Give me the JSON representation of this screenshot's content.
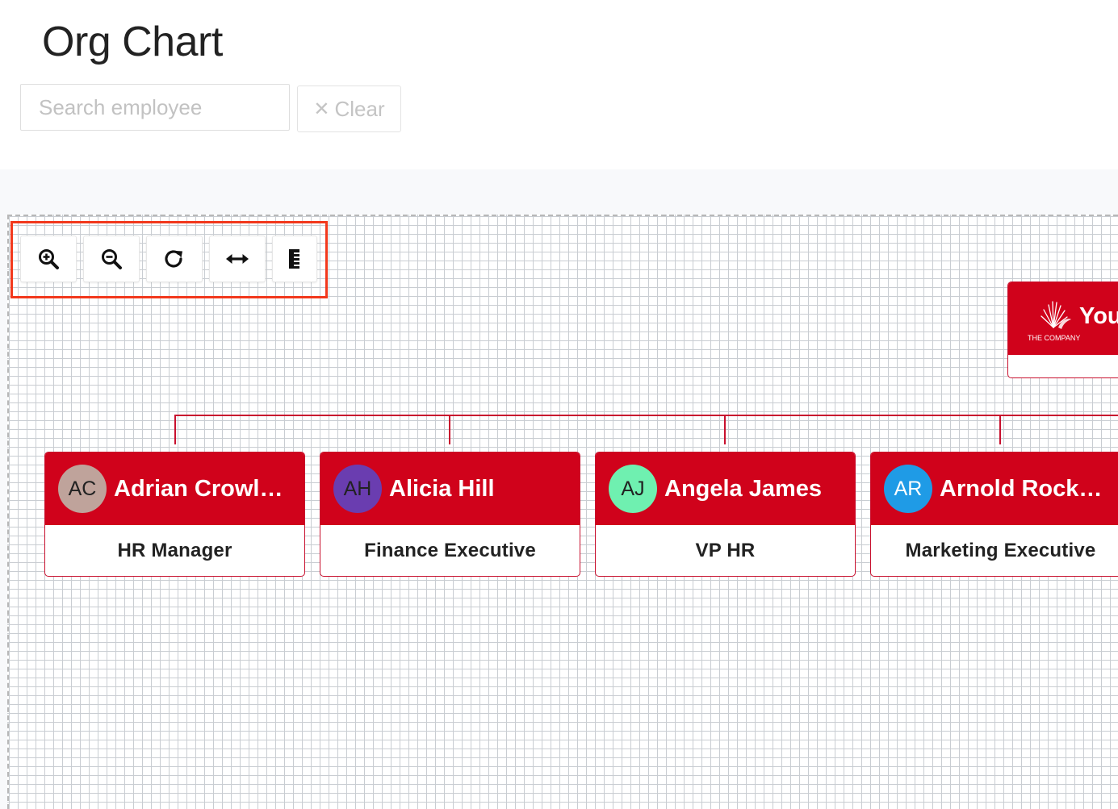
{
  "header": {
    "title": "Org Chart"
  },
  "search": {
    "placeholder": "Search employee",
    "value": "",
    "clear_icon": "✕",
    "clear_label": "Clear"
  },
  "toolbar": {
    "buttons": [
      {
        "icon": "zoom-in-icon"
      },
      {
        "icon": "zoom-out-icon"
      },
      {
        "icon": "refresh-icon"
      },
      {
        "icon": "expand-horizontal-icon"
      },
      {
        "icon": "list-icon"
      }
    ]
  },
  "colors": {
    "accent": "#d0021b",
    "highlight": "#f2381c"
  },
  "root": {
    "name": "You",
    "logo_text": "THE COMPANY"
  },
  "employees": [
    {
      "initials": "AC",
      "name": "Adrian Crowl…",
      "title": "HR Manager",
      "avatar_bg": "#bfa39b",
      "avatar_fg": "#222222"
    },
    {
      "initials": "AH",
      "name": "Alicia Hill",
      "title": "Finance Executive",
      "avatar_bg": "#6a3db0",
      "avatar_fg": "#222222"
    },
    {
      "initials": "AJ",
      "name": "Angela James",
      "title": "VP HR",
      "avatar_bg": "#6ff0b0",
      "avatar_fg": "#222222"
    },
    {
      "initials": "AR",
      "name": "Arnold Rock…",
      "title": "Marketing Executive",
      "avatar_bg": "#1f9be6",
      "avatar_fg": "#ffffff"
    }
  ]
}
